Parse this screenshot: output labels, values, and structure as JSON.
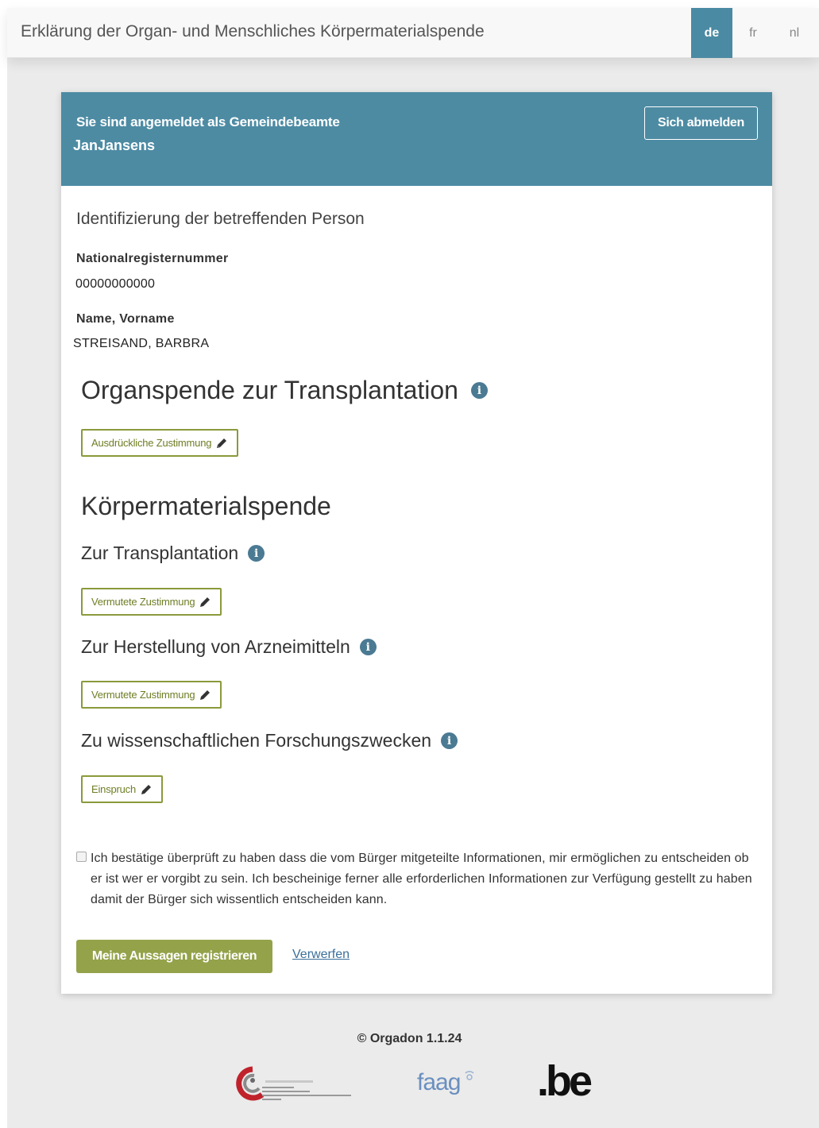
{
  "navbar": {
    "title": "Erklärung der Organ- und Menschliches Körpermaterialspende",
    "languages": [
      {
        "code": "de",
        "active": true
      },
      {
        "code": "fr",
        "active": false
      },
      {
        "code": "nl",
        "active": false
      }
    ]
  },
  "header": {
    "login_label": "Sie sind angemeldet als Gemeindebeamte",
    "user": "JanJansens",
    "logout_label": "Sich abmelden"
  },
  "identification": {
    "title": "Identifizierung der betreffenden Person",
    "nrn_label": "Nationalregisternummer",
    "nrn_value": "00000000000",
    "name_label": "Name, Vorname",
    "name_value": "STREISAND, BARBRA"
  },
  "organ": {
    "title": "Organspende zur Transplantation",
    "consent_label": "Ausdrückliche Zustimmung"
  },
  "body_material": {
    "title": "Körpermaterialspende",
    "transplant_title": "Zur Transplantation",
    "transplant_consent": "Vermutete Zustimmung",
    "medicine_title": "Zur Herstellung von Arzneimitteln",
    "medicine_consent": "Vermutete Zustimmung",
    "research_title": "Zu wissenschaftlichen Forschungszwecken",
    "research_consent": "Einspruch"
  },
  "confirmation": {
    "checked": false,
    "text": "Ich bestätige überprüft zu haben dass die vom Bürger mitgeteilte Informationen, mir ermöglichen zu entscheiden ob er ist wer er vorgibt zu sein. Ich bescheinige ferner alle erforderlichen Informationen zur Verfügung gestellt zu haben damit der Bürger sich wissentlich entscheiden kann."
  },
  "actions": {
    "submit_label": "Meine Aussagen registrieren",
    "discard_label": "Verwerfen"
  },
  "footer": {
    "copyright": "© Orgadon 1.1.24",
    "logo_faag": "faag",
    "logo_be": ".be"
  },
  "colors": {
    "header_bg": "#4d8ba3",
    "accent_green": "#94a24a",
    "info_icon": "#4b7a93"
  }
}
